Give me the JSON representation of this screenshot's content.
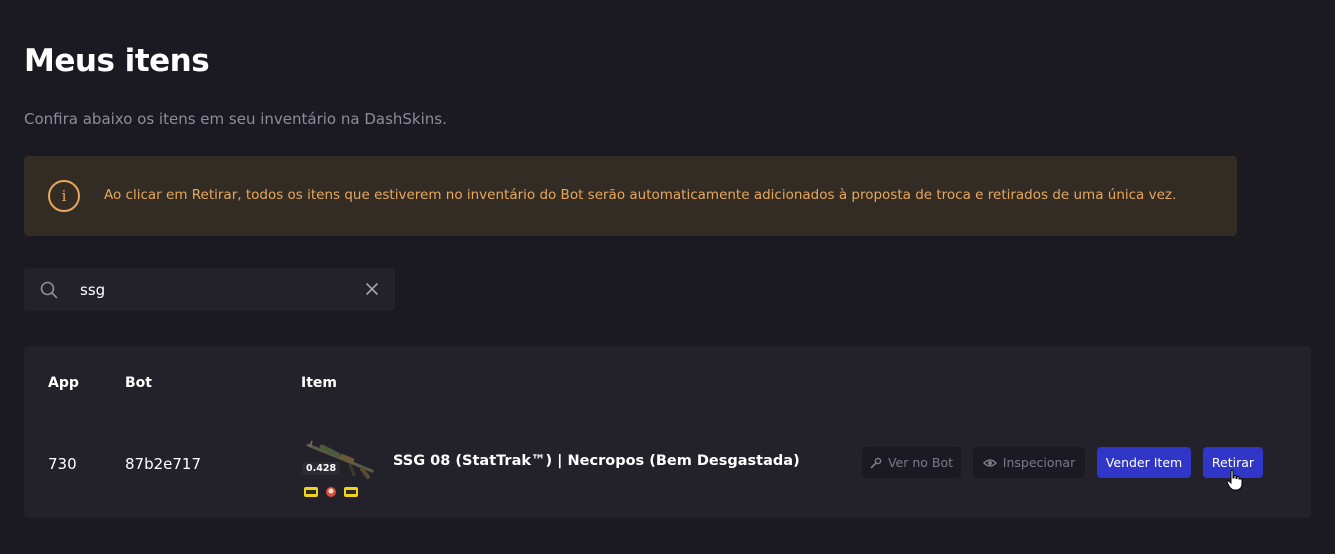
{
  "header": {
    "title": "Meus itens",
    "subtitle": "Confira abaixo os itens em seu inventário na DashSkins."
  },
  "notice": {
    "icon": "info-icon",
    "text": "Ao clicar em Retirar, todos os itens que estiverem no inventário do Bot serão automaticamente adicionados à proposta de troca e retirados de uma única vez.",
    "color": "#e8a75a",
    "background": "#332c25"
  },
  "search": {
    "value": "ssg",
    "icon": "search-icon",
    "clear_icon": "close-icon"
  },
  "table": {
    "columns": {
      "app": "App",
      "bot": "Bot",
      "item": "Item"
    },
    "rows": [
      {
        "app": "730",
        "bot": "87b2e717",
        "float": "0.428",
        "item_name": "SSG 08 (StatTrak™) | Necropos (Bem Desgastada)",
        "actions": {
          "view_bot": "Ver no Bot",
          "inspect": "Inspecionar",
          "sell": "Vender Item",
          "withdraw": "Retirar"
        }
      }
    ]
  },
  "colors": {
    "background": "#1b1a22",
    "card": "#23222b",
    "accent_blue": "#3037c8"
  }
}
